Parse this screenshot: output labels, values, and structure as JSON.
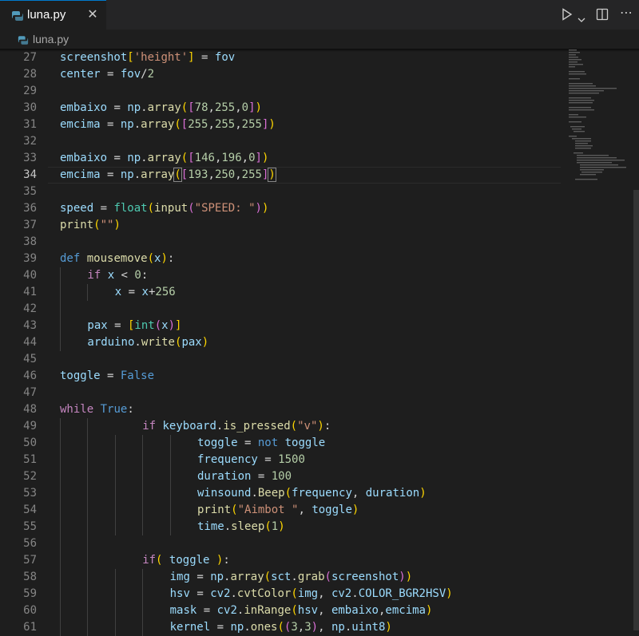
{
  "tab": {
    "title": "luna.py",
    "close": "✕"
  },
  "breadcrumb": "luna.py",
  "editor": {
    "active_line": 34,
    "lines": [
      {
        "n": 27,
        "indent": 0,
        "tokens": [
          [
            "screenshot",
            "var"
          ],
          [
            "[",
            "b1"
          ],
          [
            "'height'",
            "str"
          ],
          [
            "]",
            "b1"
          ],
          [
            " = ",
            "plain"
          ],
          [
            "fov",
            "var"
          ]
        ]
      },
      {
        "n": 28,
        "indent": 0,
        "tokens": [
          [
            "center",
            "var"
          ],
          [
            " = ",
            "plain"
          ],
          [
            "fov",
            "var"
          ],
          [
            "/",
            "plain"
          ],
          [
            "2",
            "num"
          ]
        ]
      },
      {
        "n": 29,
        "indent": 0,
        "tokens": []
      },
      {
        "n": 30,
        "indent": 0,
        "tokens": [
          [
            "embaixo",
            "var"
          ],
          [
            " = ",
            "plain"
          ],
          [
            "np",
            "var"
          ],
          [
            ".",
            "plain"
          ],
          [
            "array",
            "fn"
          ],
          [
            "(",
            "b1"
          ],
          [
            "[",
            "b2"
          ],
          [
            "78",
            "num"
          ],
          [
            ",",
            "plain"
          ],
          [
            "255",
            "num"
          ],
          [
            ",",
            "plain"
          ],
          [
            "0",
            "num"
          ],
          [
            "]",
            "b2"
          ],
          [
            ")",
            "b1"
          ]
        ]
      },
      {
        "n": 31,
        "indent": 0,
        "tokens": [
          [
            "emcima",
            "var"
          ],
          [
            " = ",
            "plain"
          ],
          [
            "np",
            "var"
          ],
          [
            ".",
            "plain"
          ],
          [
            "array",
            "fn"
          ],
          [
            "(",
            "b1"
          ],
          [
            "[",
            "b2"
          ],
          [
            "255",
            "num"
          ],
          [
            ",",
            "plain"
          ],
          [
            "255",
            "num"
          ],
          [
            ",",
            "plain"
          ],
          [
            "255",
            "num"
          ],
          [
            "]",
            "b2"
          ],
          [
            ")",
            "b1"
          ]
        ]
      },
      {
        "n": 32,
        "indent": 0,
        "tokens": []
      },
      {
        "n": 33,
        "indent": 0,
        "tokens": [
          [
            "embaixo",
            "var"
          ],
          [
            " = ",
            "plain"
          ],
          [
            "np",
            "var"
          ],
          [
            ".",
            "plain"
          ],
          [
            "array",
            "fn"
          ],
          [
            "(",
            "b1"
          ],
          [
            "[",
            "b2"
          ],
          [
            "146",
            "num"
          ],
          [
            ",",
            "plain"
          ],
          [
            "196",
            "num"
          ],
          [
            ",",
            "plain"
          ],
          [
            "0",
            "num"
          ],
          [
            "]",
            "b2"
          ],
          [
            ")",
            "b1"
          ]
        ]
      },
      {
        "n": 34,
        "indent": 0,
        "tokens": [
          [
            "emcima",
            "var"
          ],
          [
            " = ",
            "plain"
          ],
          [
            "np",
            "var"
          ],
          [
            ".",
            "plain"
          ],
          [
            "array",
            "fn"
          ],
          [
            "(",
            "b1m"
          ],
          [
            "[",
            "b2"
          ],
          [
            "193",
            "num"
          ],
          [
            ",",
            "plain"
          ],
          [
            "250",
            "num"
          ],
          [
            ",",
            "plain"
          ],
          [
            "255",
            "num"
          ],
          [
            "]",
            "b2"
          ],
          [
            ")",
            "b1m"
          ]
        ]
      },
      {
        "n": 35,
        "indent": 0,
        "tokens": []
      },
      {
        "n": 36,
        "indent": 0,
        "tokens": [
          [
            "speed",
            "var"
          ],
          [
            " = ",
            "plain"
          ],
          [
            "float",
            "cls"
          ],
          [
            "(",
            "b1"
          ],
          [
            "input",
            "fn"
          ],
          [
            "(",
            "b2"
          ],
          [
            "\"SPEED: \"",
            "str"
          ],
          [
            ")",
            "b2"
          ],
          [
            ")",
            "b1"
          ]
        ]
      },
      {
        "n": 37,
        "indent": 0,
        "tokens": [
          [
            "print",
            "fn"
          ],
          [
            "(",
            "b1"
          ],
          [
            "\"\"",
            "str"
          ],
          [
            ")",
            "b1"
          ]
        ]
      },
      {
        "n": 38,
        "indent": 0,
        "tokens": []
      },
      {
        "n": 39,
        "indent": 0,
        "tokens": [
          [
            "def",
            "kw"
          ],
          [
            " ",
            "plain"
          ],
          [
            "mousemove",
            "fn"
          ],
          [
            "(",
            "b1"
          ],
          [
            "x",
            "var"
          ],
          [
            ")",
            "b1"
          ],
          [
            ":",
            "plain"
          ]
        ]
      },
      {
        "n": 40,
        "indent": 1,
        "tokens": [
          [
            "if",
            "ctl"
          ],
          [
            " ",
            "plain"
          ],
          [
            "x",
            "var"
          ],
          [
            " < ",
            "plain"
          ],
          [
            "0",
            "num"
          ],
          [
            ":",
            "plain"
          ]
        ]
      },
      {
        "n": 41,
        "indent": 2,
        "tokens": [
          [
            "x",
            "var"
          ],
          [
            " = ",
            "plain"
          ],
          [
            "x",
            "var"
          ],
          [
            "+",
            "plain"
          ],
          [
            "256",
            "num"
          ]
        ]
      },
      {
        "n": 42,
        "indent": 1,
        "tokens": []
      },
      {
        "n": 43,
        "indent": 1,
        "tokens": [
          [
            "pax",
            "var"
          ],
          [
            " = ",
            "plain"
          ],
          [
            "[",
            "b1"
          ],
          [
            "int",
            "cls"
          ],
          [
            "(",
            "b2"
          ],
          [
            "x",
            "var"
          ],
          [
            ")",
            "b2"
          ],
          [
            "]",
            "b1"
          ]
        ]
      },
      {
        "n": 44,
        "indent": 1,
        "tokens": [
          [
            "arduino",
            "var"
          ],
          [
            ".",
            "plain"
          ],
          [
            "write",
            "fn"
          ],
          [
            "(",
            "b1"
          ],
          [
            "pax",
            "var"
          ],
          [
            ")",
            "b1"
          ]
        ]
      },
      {
        "n": 45,
        "indent": 0,
        "tokens": []
      },
      {
        "n": 46,
        "indent": 0,
        "tokens": [
          [
            "toggle",
            "var"
          ],
          [
            " = ",
            "plain"
          ],
          [
            "False",
            "kw"
          ]
        ]
      },
      {
        "n": 47,
        "indent": 0,
        "tokens": []
      },
      {
        "n": 48,
        "indent": 0,
        "tokens": [
          [
            "while",
            "ctl"
          ],
          [
            " ",
            "plain"
          ],
          [
            "True",
            "kw"
          ],
          [
            ":",
            "plain"
          ]
        ]
      },
      {
        "n": 49,
        "indent": 3,
        "tokens": [
          [
            "if",
            "ctl"
          ],
          [
            " ",
            "plain"
          ],
          [
            "keyboard",
            "var"
          ],
          [
            ".",
            "plain"
          ],
          [
            "is_pressed",
            "fn"
          ],
          [
            "(",
            "b1"
          ],
          [
            "\"v\"",
            "str"
          ],
          [
            ")",
            "b1"
          ],
          [
            ":",
            "plain"
          ]
        ]
      },
      {
        "n": 50,
        "indent": 5,
        "tokens": [
          [
            "toggle",
            "var"
          ],
          [
            " = ",
            "plain"
          ],
          [
            "not",
            "kw"
          ],
          [
            " ",
            "plain"
          ],
          [
            "toggle",
            "var"
          ]
        ]
      },
      {
        "n": 51,
        "indent": 5,
        "tokens": [
          [
            "frequency",
            "var"
          ],
          [
            " = ",
            "plain"
          ],
          [
            "1500",
            "num"
          ]
        ]
      },
      {
        "n": 52,
        "indent": 5,
        "tokens": [
          [
            "duration",
            "var"
          ],
          [
            " = ",
            "plain"
          ],
          [
            "100",
            "num"
          ]
        ]
      },
      {
        "n": 53,
        "indent": 5,
        "tokens": [
          [
            "winsound",
            "var"
          ],
          [
            ".",
            "plain"
          ],
          [
            "Beep",
            "fn"
          ],
          [
            "(",
            "b1"
          ],
          [
            "frequency",
            "var"
          ],
          [
            ", ",
            "plain"
          ],
          [
            "duration",
            "var"
          ],
          [
            ")",
            "b1"
          ]
        ]
      },
      {
        "n": 54,
        "indent": 5,
        "tokens": [
          [
            "print",
            "fn"
          ],
          [
            "(",
            "b1"
          ],
          [
            "\"Aimbot \"",
            "str"
          ],
          [
            ", ",
            "plain"
          ],
          [
            "toggle",
            "var"
          ],
          [
            ")",
            "b1"
          ]
        ]
      },
      {
        "n": 55,
        "indent": 5,
        "tokens": [
          [
            "time",
            "var"
          ],
          [
            ".",
            "plain"
          ],
          [
            "sleep",
            "fn"
          ],
          [
            "(",
            "b1"
          ],
          [
            "1",
            "num"
          ],
          [
            ")",
            "b1"
          ]
        ]
      },
      {
        "n": 56,
        "indent": 3,
        "tokens": []
      },
      {
        "n": 57,
        "indent": 3,
        "tokens": [
          [
            "if",
            "ctl"
          ],
          [
            "( ",
            "b1"
          ],
          [
            "toggle",
            "var"
          ],
          [
            " )",
            "b1"
          ],
          [
            ":",
            "plain"
          ]
        ]
      },
      {
        "n": 58,
        "indent": 4,
        "tokens": [
          [
            "img",
            "var"
          ],
          [
            " = ",
            "plain"
          ],
          [
            "np",
            "var"
          ],
          [
            ".",
            "plain"
          ],
          [
            "array",
            "fn"
          ],
          [
            "(",
            "b1"
          ],
          [
            "sct",
            "var"
          ],
          [
            ".",
            "plain"
          ],
          [
            "grab",
            "fn"
          ],
          [
            "(",
            "b2"
          ],
          [
            "screenshot",
            "var"
          ],
          [
            ")",
            "b2"
          ],
          [
            ")",
            "b1"
          ]
        ]
      },
      {
        "n": 59,
        "indent": 4,
        "tokens": [
          [
            "hsv",
            "var"
          ],
          [
            " = ",
            "plain"
          ],
          [
            "cv2",
            "var"
          ],
          [
            ".",
            "plain"
          ],
          [
            "cvtColor",
            "fn"
          ],
          [
            "(",
            "b1"
          ],
          [
            "img",
            "var"
          ],
          [
            ", ",
            "plain"
          ],
          [
            "cv2",
            "var"
          ],
          [
            ".",
            "plain"
          ],
          [
            "COLOR_BGR2HSV",
            "var"
          ],
          [
            ")",
            "b1"
          ]
        ]
      },
      {
        "n": 60,
        "indent": 4,
        "tokens": [
          [
            "mask",
            "var"
          ],
          [
            " = ",
            "plain"
          ],
          [
            "cv2",
            "var"
          ],
          [
            ".",
            "plain"
          ],
          [
            "inRange",
            "fn"
          ],
          [
            "(",
            "b1"
          ],
          [
            "hsv",
            "var"
          ],
          [
            ", ",
            "plain"
          ],
          [
            "embaixo",
            "var"
          ],
          [
            ",",
            "plain"
          ],
          [
            "emcima",
            "var"
          ],
          [
            ")",
            "b1"
          ]
        ]
      },
      {
        "n": 61,
        "indent": 4,
        "tokens": [
          [
            "kernel",
            "var"
          ],
          [
            " = ",
            "plain"
          ],
          [
            "np",
            "var"
          ],
          [
            ".",
            "plain"
          ],
          [
            "ones",
            "fn"
          ],
          [
            "(",
            "b1"
          ],
          [
            "(",
            "b2"
          ],
          [
            "3",
            "num"
          ],
          [
            ",",
            "plain"
          ],
          [
            "3",
            "num"
          ],
          [
            ")",
            "b2"
          ],
          [
            ", ",
            "plain"
          ],
          [
            "np",
            "var"
          ],
          [
            ".",
            "plain"
          ],
          [
            "uint8",
            "var"
          ],
          [
            ")",
            "b1"
          ]
        ]
      }
    ]
  },
  "colors": {
    "background": "#1e1e1e",
    "tab_bar": "#252526",
    "accent": "#007acc",
    "keyword": "#569cd6",
    "control": "#c586c0",
    "function": "#dcdcaa",
    "variable": "#9cdcfe",
    "string": "#ce9178",
    "number": "#b5cea8",
    "class": "#4ec9b0"
  },
  "icons": [
    "python-file-icon",
    "close-icon",
    "run-icon",
    "chevron-down-icon",
    "split-editor-icon",
    "more-actions-icon"
  ]
}
